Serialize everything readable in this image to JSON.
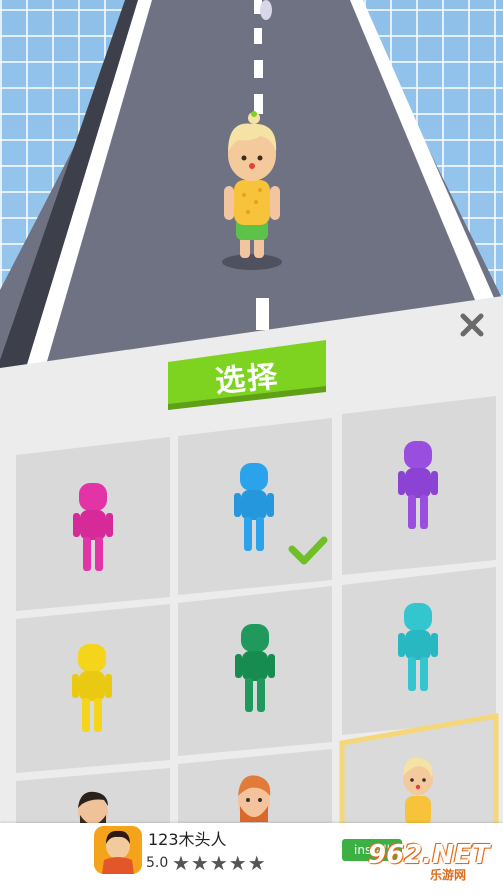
{
  "panel": {
    "title": "选择",
    "close_icon": "close-icon",
    "checkmark_icon": "checkmark-icon"
  },
  "skins": [
    {
      "id": "magenta",
      "color": "#e233a7",
      "selected": false
    },
    {
      "id": "blue",
      "color": "#2ba3ec",
      "selected": true
    },
    {
      "id": "purple",
      "color": "#9a4ee0",
      "selected": false
    },
    {
      "id": "yellow",
      "color": "#f5d51c",
      "selected": false
    },
    {
      "id": "green",
      "color": "#1f9a5c",
      "selected": false
    },
    {
      "id": "cyan",
      "color": "#33c6cf",
      "selected": false
    },
    {
      "id": "man-with-beard",
      "color": "#6b4a32",
      "selected": false
    },
    {
      "id": "ginger-man",
      "color": "#e27b3a",
      "selected": false
    },
    {
      "id": "blonde-girl",
      "color": "#f2d08a",
      "selected": false,
      "highlighted": true
    }
  ],
  "player": {
    "character": "blonde-girl"
  },
  "ad": {
    "title": "123木头人",
    "rating": "5.0",
    "stars": "★★★★★",
    "install_label": "install",
    "watermark": "962.NET",
    "watermark_sub": "乐游网"
  },
  "colors": {
    "accent_green": "#7ed321",
    "road": "#6b6e80",
    "tile_bg": "#d9d9d9",
    "highlight_border": "#f5d77a"
  }
}
